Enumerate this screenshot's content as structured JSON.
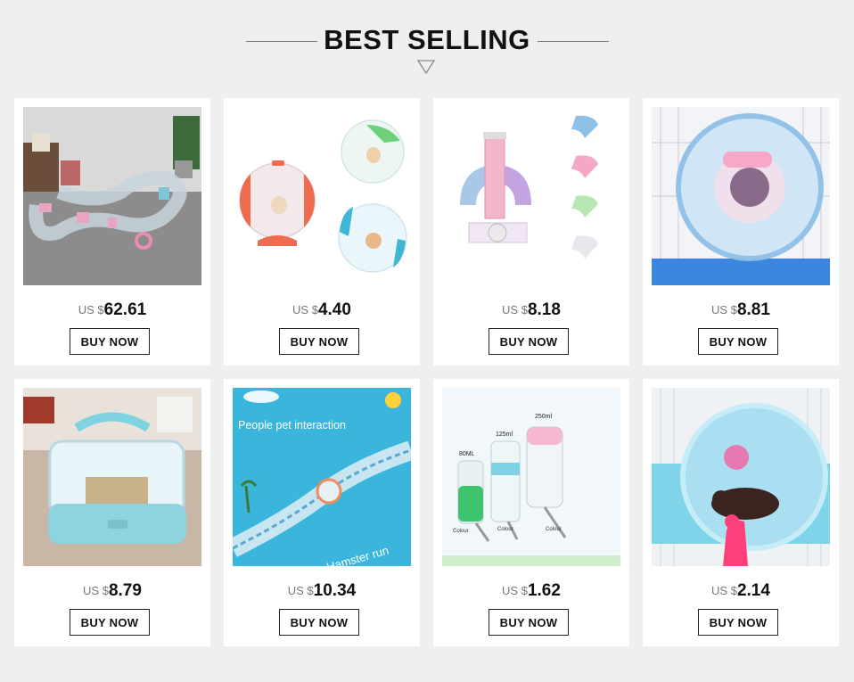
{
  "header": {
    "title": "BEST SELLING"
  },
  "products": [
    {
      "currency": "US $",
      "price": "62.61",
      "button": "BUY NOW",
      "image": "hamster-tube-track-photo"
    },
    {
      "currency": "US $",
      "price": "4.40",
      "button": "BUY NOW",
      "image": "hamster-exercise-ball-photo"
    },
    {
      "currency": "US $",
      "price": "8.18",
      "button": "BUY NOW",
      "image": "hamster-tube-connectors-photo"
    },
    {
      "currency": "US $",
      "price": "8.81",
      "button": "BUY NOW",
      "image": "hamster-wheel-in-cage-photo"
    },
    {
      "currency": "US $",
      "price": "8.79",
      "button": "BUY NOW",
      "image": "hamster-carry-cage-photo"
    },
    {
      "currency": "US $",
      "price": "10.34",
      "button": "BUY NOW",
      "image": "hamster-run-track-ad",
      "image_text": [
        "People pet interaction",
        "Hamster run"
      ]
    },
    {
      "currency": "US $",
      "price": "1.62",
      "button": "BUY NOW",
      "image": "pet-water-bottles-photo",
      "image_text": [
        "80ML",
        "125ml",
        "250ml",
        "Colour",
        "Colour",
        "Colour"
      ]
    },
    {
      "currency": "US $",
      "price": "2.14",
      "button": "BUY NOW",
      "image": "hamster-silent-wheel-photo"
    }
  ]
}
